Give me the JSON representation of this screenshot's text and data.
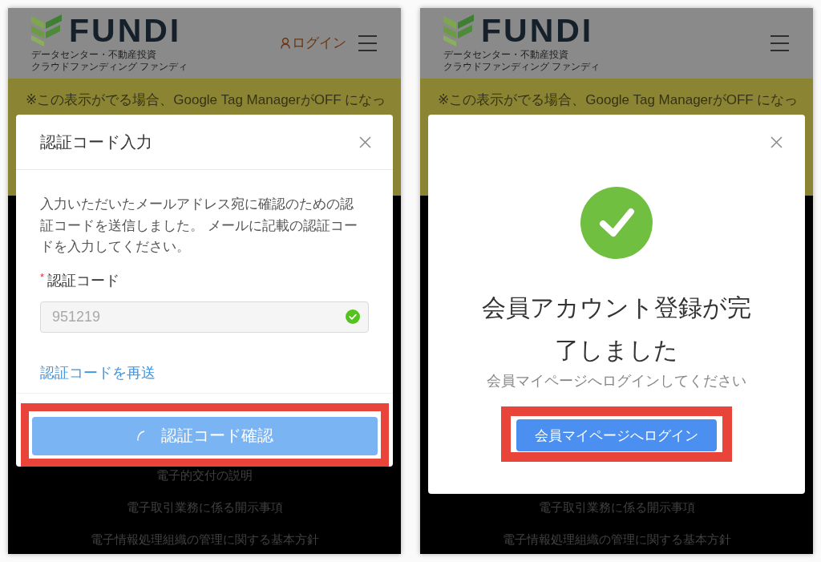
{
  "screens": [
    {
      "header": {
        "logo_text": "FUNDI",
        "tagline": [
          "データセンター・不動産投資",
          "クラウドファンディング ファンディ"
        ],
        "login_link": "ログイン"
      },
      "notice": "※この表示がでる場合、Google Tag ManagerがOFF になっ",
      "modal": {
        "kind": "form",
        "title": "認証コード入力",
        "message": "入力いただいたメールアドレス宛に確認のための認証コードを送信しました。 メールに記載の認証コードを入力してください。",
        "field": {
          "required_mark": "*",
          "label": "認証コード",
          "value": "951219",
          "disabled": true,
          "valid": true
        },
        "resend_link": "認証コードを再送",
        "button": {
          "label": "認証コード確認",
          "loading": true,
          "highlighted": true
        }
      },
      "footer_links": [
        "電子的交付の説明",
        "電子取引業務に係る開示事項",
        "電子情報処理組織の管理に関する基本方針"
      ]
    },
    {
      "header": {
        "logo_text": "FUNDI",
        "tagline": [
          "データセンター・不動産投資",
          "クラウドファンディング ファンディ"
        ]
      },
      "notice": "※この表示がでる場合、Google Tag ManagerがOFF になっ",
      "modal": {
        "kind": "success",
        "title": "会員アカウント登録が完了しました",
        "message": "会員マイページへログインしてください",
        "button": {
          "label": "会員マイページへログイン",
          "loading": false,
          "highlighted": true
        }
      },
      "footer_links": [
        "電子取引業務に係る開示事項",
        "電子情報処理組織の管理に関する基本方針"
      ]
    }
  ]
}
